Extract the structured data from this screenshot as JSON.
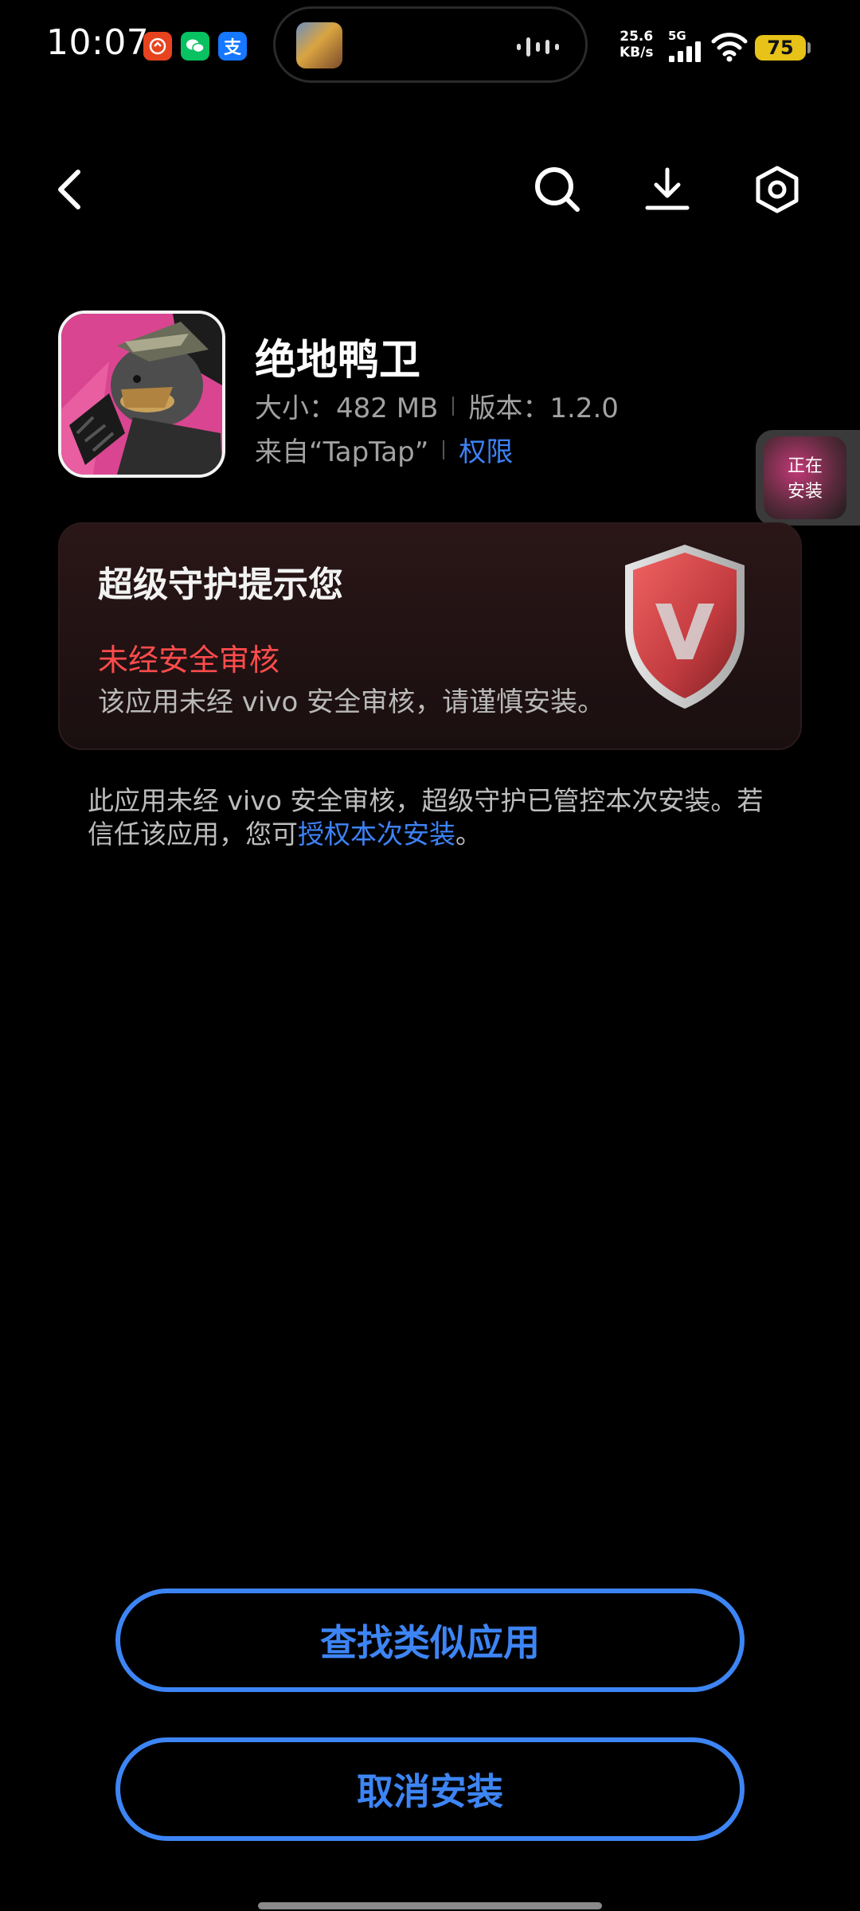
{
  "status_bar": {
    "time": "10:07",
    "notification_icons": [
      "taobao-icon",
      "wechat-icon",
      "alipay-icon"
    ],
    "alipay_glyph": "支",
    "net_speed_value": "25.6",
    "net_speed_unit": "KB/s",
    "network_type": "5G",
    "battery_level": "75"
  },
  "header": {
    "icons": [
      "back-icon",
      "search-icon",
      "download-icon",
      "settings-icon"
    ]
  },
  "app": {
    "name": "绝地鸭卫",
    "size_label": "大小：482 MB",
    "version_label": "版本：1.2.0",
    "source_label": "来自“TapTap”",
    "permissions_link": "权限"
  },
  "installing_bubble": {
    "line1": "正在",
    "line2": "安装"
  },
  "security_card": {
    "title": "超级守护提示您",
    "warning": "未经安全审核",
    "description": "该应用未经 vivo 安全审核，请谨慎安装。"
  },
  "note": {
    "text_main": "此应用未经 vivo 安全审核，超级守护已管控本次安装。若信任该应用，您可",
    "link": "授权本次安装",
    "text_end": "。"
  },
  "buttons": {
    "find_similar": "查找类似应用",
    "cancel_install": "取消安装"
  },
  "colors": {
    "accent_blue": "#3d85f5",
    "warning_red": "#ff4b4b",
    "battery_yellow": "#e7c218"
  }
}
